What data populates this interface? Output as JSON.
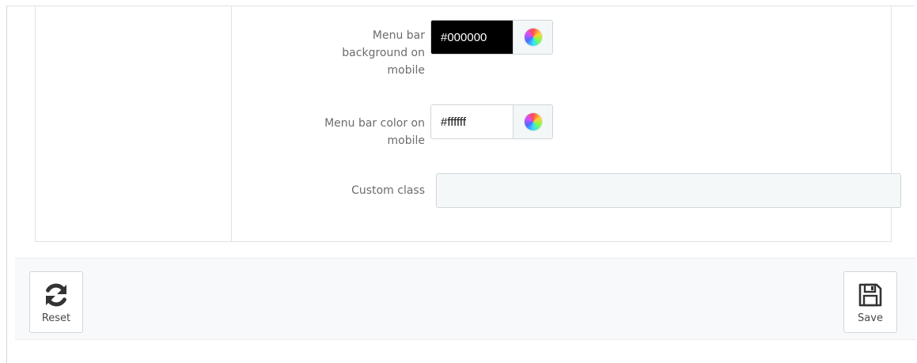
{
  "form": {
    "menu_bar_bg_mobile": {
      "label_line1": "Menu bar",
      "label_line2": "background on",
      "label_line3": "mobile",
      "value": "#000000"
    },
    "menu_bar_color_mobile": {
      "label_line1": "Menu bar color on",
      "label_line2": "mobile",
      "value": "#ffffff"
    },
    "custom_class": {
      "label": "Custom class",
      "value": ""
    }
  },
  "toolbar": {
    "reset_label": "Reset",
    "save_label": "Save"
  },
  "colors": {
    "panel_border": "#dde3e6",
    "footer_bg": "#f8f9fa",
    "input_bg": "#f5f8f9"
  }
}
